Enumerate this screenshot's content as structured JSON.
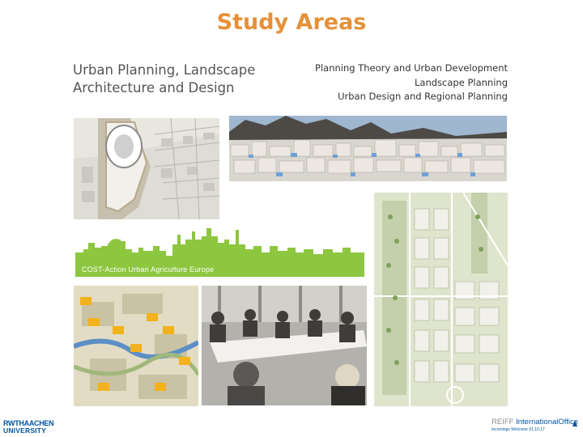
{
  "slide": {
    "title": "Study Areas",
    "left_subtitle": "Urban Planning, Landscape Architecture and Design",
    "right_lines": [
      "Planning Theory and Urban Development",
      "Landscape Planning",
      "Urban Design and Regional Planning"
    ]
  },
  "images": {
    "skyline_caption": "COST-Action Urban Agriculture Europe"
  },
  "footer": {
    "left_logo_line1": "RWTHAACHEN",
    "left_logo_line2": "UNIVERSITY",
    "right_logo_a": "REIFF",
    "right_logo_b": "InternationalOffice",
    "right_logo_sub": "Incomings Welcome 01.10.17"
  },
  "colors": {
    "title": "#e69138",
    "green": "#8dc63f",
    "rwth_blue": "#00549f"
  }
}
